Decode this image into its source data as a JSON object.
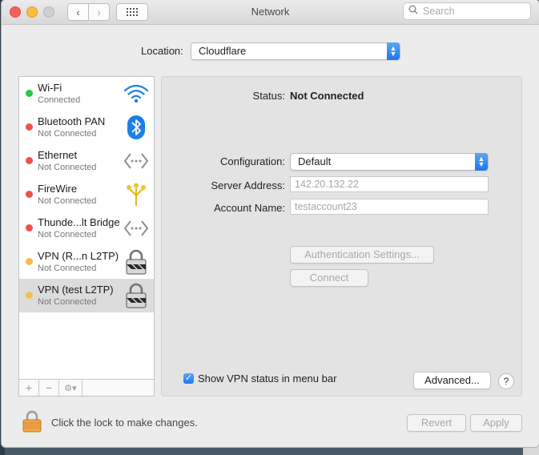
{
  "window": {
    "title": "Network"
  },
  "search": {
    "placeholder": "Search"
  },
  "location": {
    "label": "Location:",
    "value": "Cloudflare"
  },
  "services": [
    {
      "name": "Wi-Fi",
      "status": "Connected",
      "dot_color": "#28c840",
      "icon": "wifi-icon"
    },
    {
      "name": "Bluetooth PAN",
      "status": "Not Connected",
      "dot_color": "#f0504a",
      "icon": "bluetooth-icon"
    },
    {
      "name": "Ethernet",
      "status": "Not Connected",
      "dot_color": "#f0504a",
      "icon": "ethernet-icon"
    },
    {
      "name": "FireWire",
      "status": "Not Connected",
      "dot_color": "#f0504a",
      "icon": "firewire-icon"
    },
    {
      "name": "Thunde...lt Bridge",
      "status": "Not Connected",
      "dot_color": "#f0504a",
      "icon": "thunderbolt-bridge-icon"
    },
    {
      "name": "VPN (R...n L2TP)",
      "status": "Not Connected",
      "dot_color": "#f5bd4f",
      "icon": "vpn-lock-icon"
    },
    {
      "name": "VPN (test L2TP)",
      "status": "Not Connected",
      "dot_color": "#f5bd4f",
      "icon": "vpn-lock-icon",
      "selected": true
    }
  ],
  "sidebar_buttons": {
    "add": "+",
    "remove": "−",
    "gear": "⚙▾"
  },
  "detail": {
    "status_label": "Status:",
    "status_value": "Not Connected",
    "configuration_label": "Configuration:",
    "configuration_value": "Default",
    "server_label": "Server Address:",
    "server_value": "142.20.132.22",
    "account_label": "Account Name:",
    "account_value": "testaccount23",
    "auth_button": "Authentication Settings...",
    "connect_button": "Connect",
    "show_vpn_label": "Show VPN status in menu bar",
    "show_vpn_checked": true,
    "advanced_button": "Advanced...",
    "help": "?"
  },
  "footer": {
    "lock_text": "Click the lock to make changes.",
    "revert": "Revert",
    "apply": "Apply"
  }
}
